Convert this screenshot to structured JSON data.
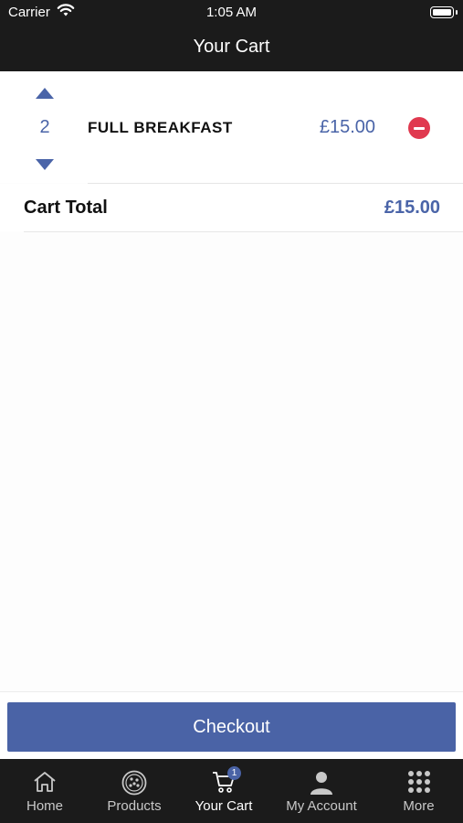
{
  "status_bar": {
    "carrier": "Carrier",
    "time": "1:05 AM"
  },
  "header": {
    "title": "Your Cart"
  },
  "cart": {
    "items": [
      {
        "quantity": "2",
        "name": "FULL BREAKFAST",
        "price": "£15.00"
      }
    ],
    "total_label": "Cart Total",
    "total_value": "£15.00"
  },
  "checkout": {
    "label": "Checkout"
  },
  "tab_bar": {
    "tabs": [
      {
        "label": "Home",
        "icon": "home-icon"
      },
      {
        "label": "Products",
        "icon": "pizza-icon"
      },
      {
        "label": "Your Cart",
        "icon": "cart-icon",
        "badge": "1",
        "active": true
      },
      {
        "label": "My Account",
        "icon": "person-icon"
      },
      {
        "label": "More",
        "icon": "grid-icon"
      }
    ]
  },
  "colors": {
    "accent": "#4a63a6",
    "remove": "#e0394f",
    "bar": "#1b1b1b"
  }
}
